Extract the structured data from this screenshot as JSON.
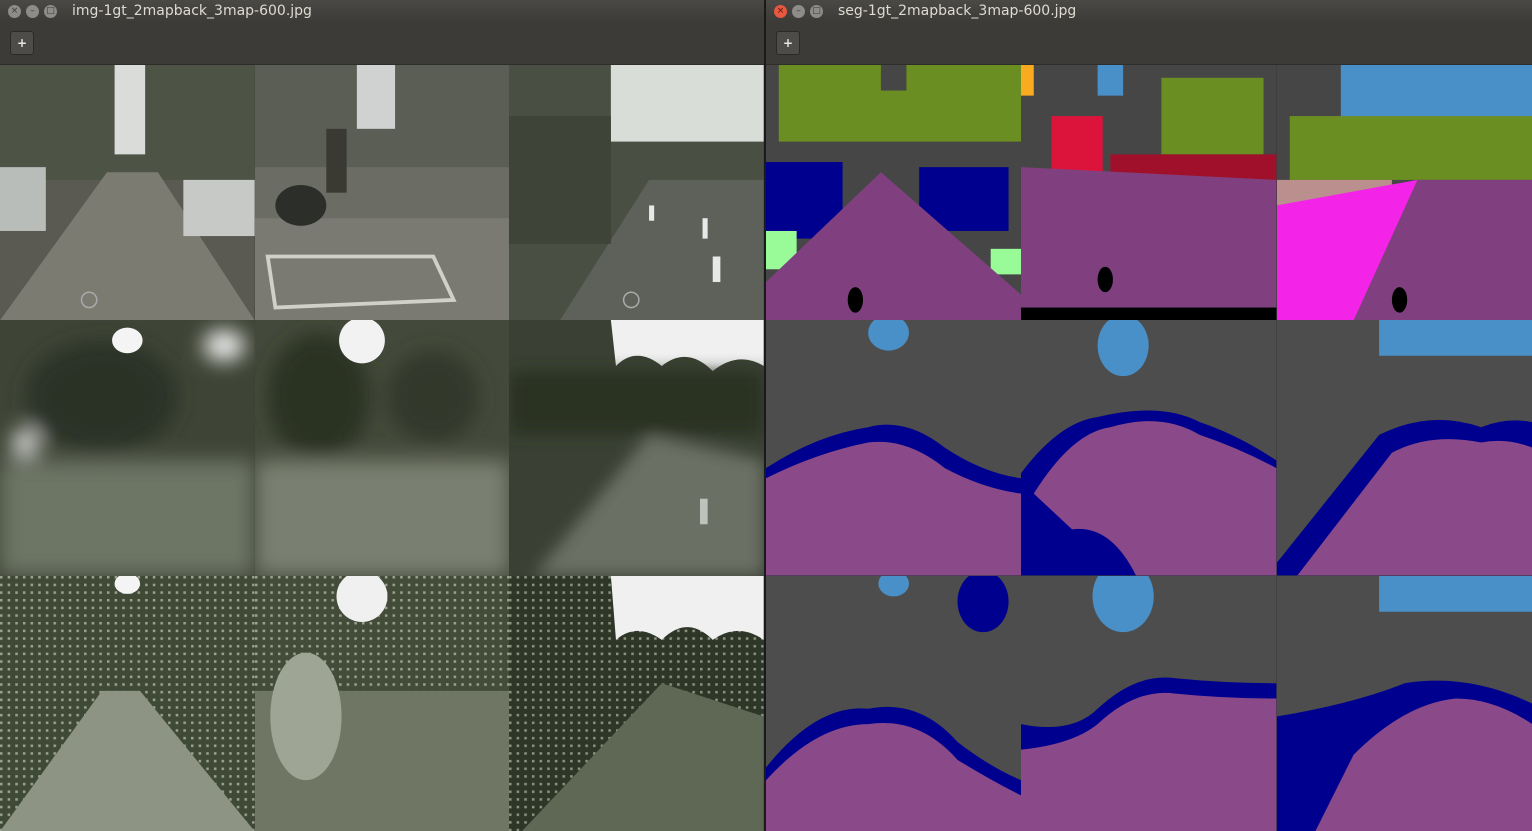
{
  "windows": {
    "left": {
      "title": "img-1gt_2mapback_3map-600.jpg",
      "toolbar_icon": "plus-square-icon",
      "tiles": [
        "real-street-photo",
        "real-street-photo",
        "real-street-photo",
        "generated-blurry-photo",
        "generated-blurry-photo",
        "generated-blurry-photo",
        "generated-noisy-photo",
        "generated-noisy-photo",
        "generated-noisy-photo"
      ]
    },
    "right": {
      "title": "seg-1gt_2mapback_3map-600.jpg",
      "toolbar_icon": "plus-square-icon",
      "tiles": [
        "segmentation-map",
        "segmentation-map",
        "segmentation-map",
        "predicted-segmentation",
        "predicted-segmentation",
        "predicted-segmentation",
        "predicted-segmentation",
        "predicted-segmentation",
        "predicted-segmentation"
      ]
    }
  },
  "window_buttons": {
    "close": "×",
    "minimize": "–",
    "maximize": "□"
  },
  "colors": {
    "road": "#8a4a8a",
    "sky": "#4a90c8",
    "vegetation": "#6b8e23",
    "building": "#4a4a4a",
    "car": "#00008e",
    "sidewalk": "#f423e8",
    "person": "#dc143c",
    "terrain": "#98fb98"
  }
}
